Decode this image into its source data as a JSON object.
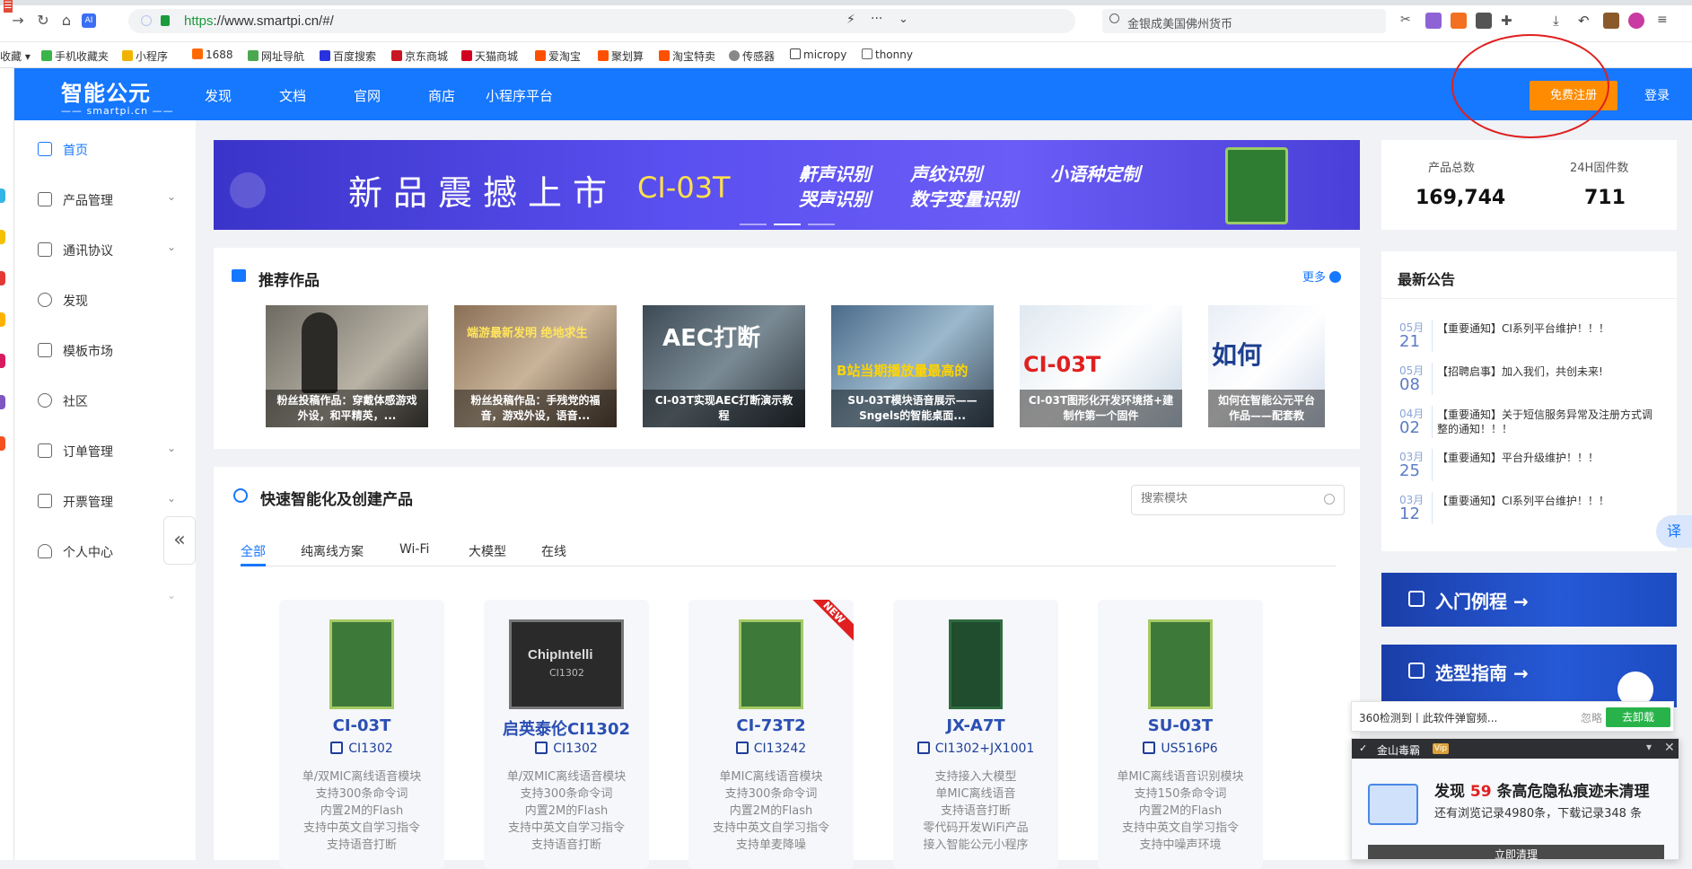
{
  "browser": {
    "url_https": "https",
    "url_rest": "://www.smartpi.cn/#/",
    "search_text": "金银成美国佛州货币",
    "bookmarks": [
      "收藏",
      "手机收藏夹",
      "小程序",
      "1688",
      "网址导航",
      "百度搜索",
      "京东商城",
      "天猫商城",
      "爱淘宝",
      "聚划算",
      "淘宝特卖",
      "传感器",
      "micropy",
      "thonny"
    ]
  },
  "header": {
    "logo_main": "智能公元",
    "logo_sub": "smartpi.cn",
    "nav": [
      "发现",
      "文档",
      "官网",
      "商店",
      "小程序平台"
    ],
    "register": "免费注册",
    "login": "登录"
  },
  "menu": {
    "items": [
      {
        "label": "首页"
      },
      {
        "label": "产品管理"
      },
      {
        "label": "通讯协议"
      },
      {
        "label": "发现"
      },
      {
        "label": "模板市场"
      },
      {
        "label": "社区"
      },
      {
        "label": "订单管理"
      },
      {
        "label": "开票管理"
      },
      {
        "label": "个人中心"
      }
    ],
    "collapse": "«"
  },
  "banner": {
    "title": "新品震撼上市",
    "model": "CI-03T",
    "tags": [
      "鼾声识别",
      "哭声识别",
      "声纹识别",
      "数字变量识别",
      "小语种定制"
    ]
  },
  "stats": {
    "total_label": "产品总数",
    "total_value": "169,744",
    "firmware_label": "24H固件数",
    "firmware_value": "711"
  },
  "recommend": {
    "title": "推荐作品",
    "more": "更多",
    "works": [
      {
        "caption": "粉丝投稿作品：穿戴体感游戏外设，和平精英，..."
      },
      {
        "caption": "粉丝投稿作品：手残党的福音，游戏外设，语音..."
      },
      {
        "caption": "CI-03T实现AEC打断演示教程"
      },
      {
        "caption": "SU-03T模块语音展示——Sngels的智能桌面..."
      },
      {
        "caption": "CI-03T图形化开发环境搭+建制作第一个固件"
      },
      {
        "caption": "如何在智能公元平台作品——配套教"
      }
    ],
    "work_overlays": [
      "",
      "端游最新发明 绝地求生",
      "AEC打断",
      "B站当期播放量最高的",
      "CI-03T",
      "如何"
    ]
  },
  "quick": {
    "title": "快速智能化及创建产品",
    "search_placeholder": "搜索模块",
    "tabs": [
      "全部",
      "纯离线方案",
      "Wi-Fi",
      "大模型",
      "在线"
    ],
    "products": [
      {
        "name": "CI-03T",
        "chip": "CI1302",
        "desc": [
          "单/双MIC离线语音模块",
          "支持300条命令词",
          "内置2M的Flash",
          "支持中英文自学习指令",
          "支持语音打断"
        ]
      },
      {
        "name": "启英泰伦CI1302",
        "chip": "CI1302",
        "desc": [
          "单/双MIC离线语音模块",
          "支持300条命令词",
          "内置2M的Flash",
          "支持中英文自学习指令",
          "支持语音打断"
        ]
      },
      {
        "name": "CI-73T2",
        "chip": "CI13242",
        "new": "NEW",
        "desc": [
          "单MIC离线语音模块",
          "支持300条命令词",
          "内置2M的Flash",
          "支持中英文自学习指令",
          "支持单麦降噪"
        ]
      },
      {
        "name": "JX-A7T",
        "chip": "CI1302+JX1001",
        "desc": [
          "支持接入大模型",
          "单MIC离线语音",
          "支持语音打断",
          "零代码开发WiFi产品",
          "接入智能公元小程序"
        ]
      },
      {
        "name": "SU-03T",
        "chip": "US516P6",
        "desc": [
          "单MIC离线语音识别模块",
          "支持150条命令词",
          "内置2M的Flash",
          "支持中英文自学习指令",
          "支持中噪声环境"
        ]
      }
    ],
    "chip_label": "ChipIntelli"
  },
  "announce": {
    "title": "最新公告",
    "items": [
      {
        "month": "05月",
        "day": "21",
        "text": "【重要通知】CI系列平台维护！！！"
      },
      {
        "month": "05月",
        "day": "08",
        "text": "【招聘启事】加入我们，共创未来!"
      },
      {
        "month": "04月",
        "day": "02",
        "text": "【重要通知】关于短信服务异常及注册方式调整的通知！！！"
      },
      {
        "month": "03月",
        "day": "25",
        "text": "【重要通知】平台升级维护！！！"
      },
      {
        "month": "03月",
        "day": "12",
        "text": "【重要通知】CI系列平台维护！！！"
      }
    ]
  },
  "side_banners": {
    "intro": "入门例程 →",
    "guide": "选型指南 →"
  },
  "translate": "译",
  "popup360": {
    "text": "360检测到丨此软件弹窗频...",
    "ignore": "忽略",
    "uninstall": "去卸载"
  },
  "kingsoft": {
    "brand": "金山毒霸",
    "vip": "Vip",
    "title_pre": "发现",
    "title_num": "59",
    "title_post": "条高危隐私痕迹未清理",
    "sub": "还有浏览记录4980条，下载记录348 条",
    "button": "立即清理"
  },
  "colors": {
    "brand_blue": "#1677ff",
    "register_orange": "#ff8c00",
    "annotation_red": "#e02020"
  }
}
